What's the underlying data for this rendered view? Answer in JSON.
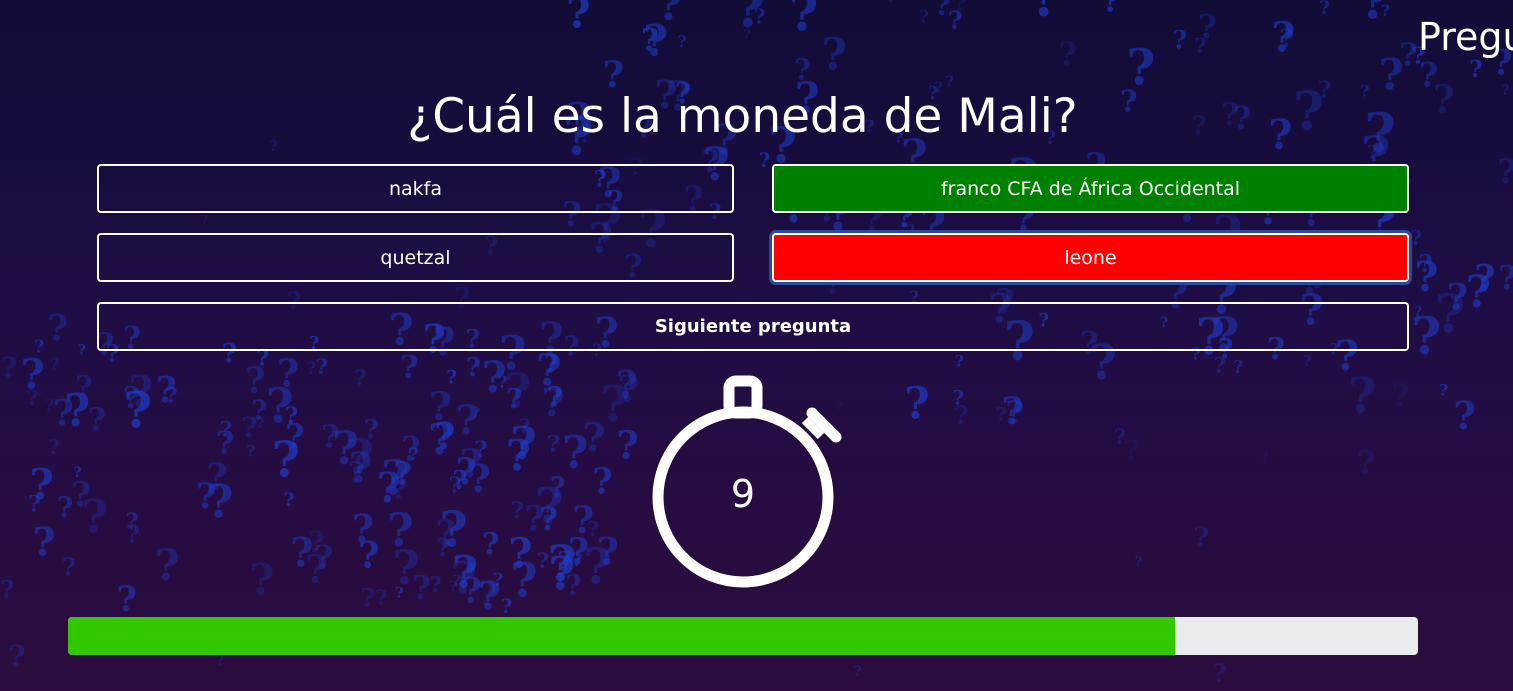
{
  "header": {
    "title": "Pregu"
  },
  "question": {
    "text": "¿Cuál es la moneda de Mali?"
  },
  "answers": [
    {
      "label": "nakfa",
      "state": "neutral"
    },
    {
      "label": "franco CFA de África Occidental",
      "state": "correct"
    },
    {
      "label": "quetzal",
      "state": "neutral"
    },
    {
      "label": "leone",
      "state": "wrong"
    }
  ],
  "controls": {
    "next_label": "Siguiente pregunta"
  },
  "timer": {
    "value": "9",
    "icon": "stopwatch-icon"
  },
  "progress": {
    "fraction": 0.82
  },
  "colors": {
    "correct": "#008000",
    "wrong": "#ff0000",
    "progress_fill": "#33c700",
    "progress_track": "#e9ecef",
    "background": "#1a0d40",
    "pattern": "#1f3cc9"
  },
  "background": {
    "pattern_icon": "question-mark-icon"
  }
}
